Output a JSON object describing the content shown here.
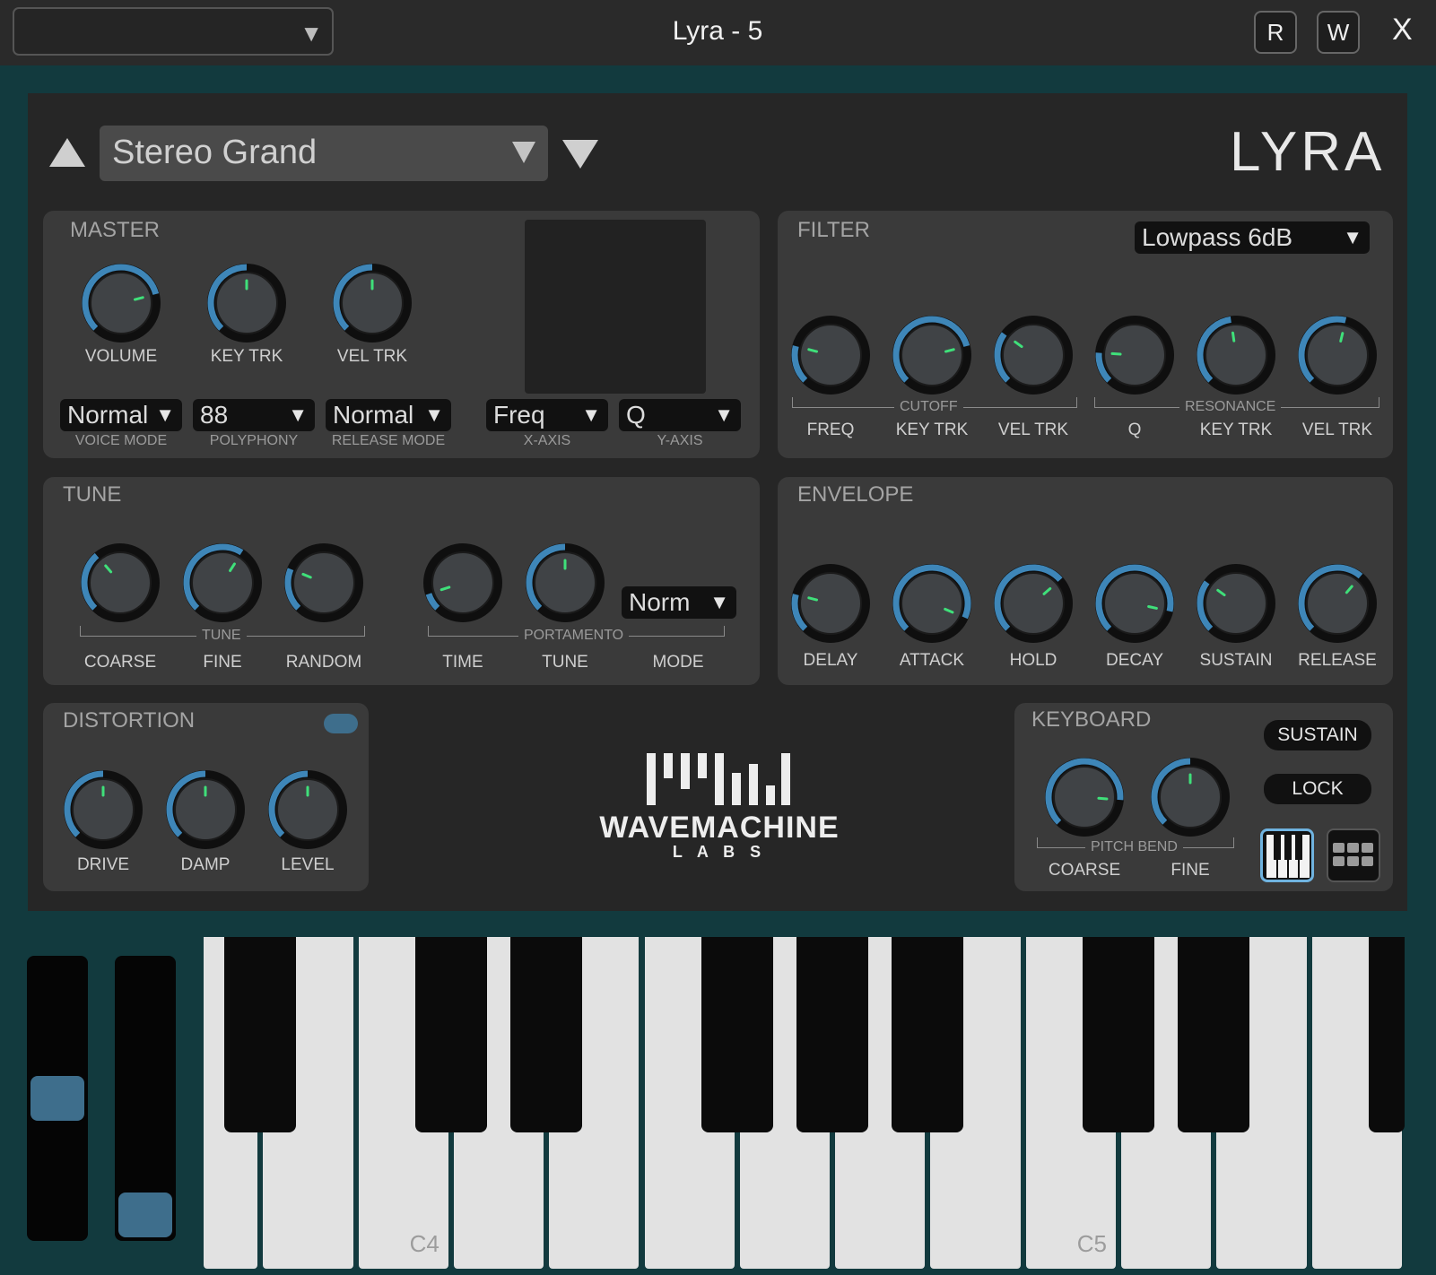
{
  "titlebar": {
    "host_preset_value": "",
    "title": "Lyra - 5",
    "r_button": "R",
    "w_button": "W",
    "close": "X"
  },
  "preset": {
    "name": "Stereo Grand",
    "logo": "LYRA"
  },
  "colors": {
    "accent": "#3e86b8",
    "indicator": "#3fe07a",
    "panel": "#3a3a3a",
    "frame": "#123a3e"
  },
  "master": {
    "title": "MASTER",
    "knobs": [
      {
        "label": "VOLUME",
        "value": 0.78
      },
      {
        "label": "KEY TRK",
        "value": 0.5
      },
      {
        "label": "VEL TRK",
        "value": 0.5
      }
    ],
    "selects": [
      {
        "value": "Normal",
        "caption": "VOICE MODE"
      },
      {
        "value": "88",
        "caption": "POLYPHONY"
      },
      {
        "value": "Normal",
        "caption": "RELEASE MODE"
      },
      {
        "value": "Freq",
        "caption": "X-AXIS"
      },
      {
        "value": "Q",
        "caption": "Y-AXIS"
      }
    ]
  },
  "filter": {
    "title": "FILTER",
    "type": "Lowpass 6dB",
    "group_cutoff": "CUTOFF",
    "group_resonance": "RESONANCE",
    "knobs": [
      {
        "label": "FREQ",
        "value": 0.22
      },
      {
        "label": "KEY TRK",
        "value": 0.78
      },
      {
        "label": "VEL TRK",
        "value": 0.3
      },
      {
        "label": "Q",
        "value": 0.18
      },
      {
        "label": "KEY TRK",
        "value": 0.47
      },
      {
        "label": "VEL TRK",
        "value": 0.55
      }
    ]
  },
  "tune": {
    "title": "TUNE",
    "group_tune": "TUNE",
    "group_portamento": "PORTAMENTO",
    "mode_value": "Norm",
    "knobs": [
      {
        "label": "COARSE",
        "value": 0.35
      },
      {
        "label": "FINE",
        "value": 0.62
      },
      {
        "label": "RANDOM",
        "value": 0.25
      },
      {
        "label": "TIME",
        "value": 0.1
      },
      {
        "label": "TUNE",
        "value": 0.5
      }
    ],
    "mode_label": "MODE"
  },
  "envelope": {
    "title": "ENVELOPE",
    "knobs": [
      {
        "label": "DELAY",
        "value": 0.22
      },
      {
        "label": "ATTACK",
        "value": 0.92
      },
      {
        "label": "HOLD",
        "value": 0.68
      },
      {
        "label": "DECAY",
        "value": 0.88
      },
      {
        "label": "SUSTAIN",
        "value": 0.3
      },
      {
        "label": "RELEASE",
        "value": 0.65
      }
    ]
  },
  "distortion": {
    "title": "DISTORTION",
    "enabled": true,
    "knobs": [
      {
        "label": "DRIVE",
        "value": 0.5
      },
      {
        "label": "DAMP",
        "value": 0.5
      },
      {
        "label": "LEVEL",
        "value": 0.5
      }
    ]
  },
  "brand": {
    "name": "WAVEMACHINE",
    "sub": "L A B S"
  },
  "keyboard": {
    "title": "KEYBOARD",
    "sustain": "SUSTAIN",
    "lock": "LOCK",
    "group_pitchbend": "PITCH BEND",
    "knobs": [
      {
        "label": "COARSE",
        "value": 0.85
      },
      {
        "label": "FINE",
        "value": 0.5
      }
    ],
    "icons": [
      "piano-view-icon",
      "pad-grid-icon"
    ],
    "c4": "C4",
    "c5": "C5",
    "pitch_wheel": 0.5,
    "mod_wheel": 0.0
  }
}
